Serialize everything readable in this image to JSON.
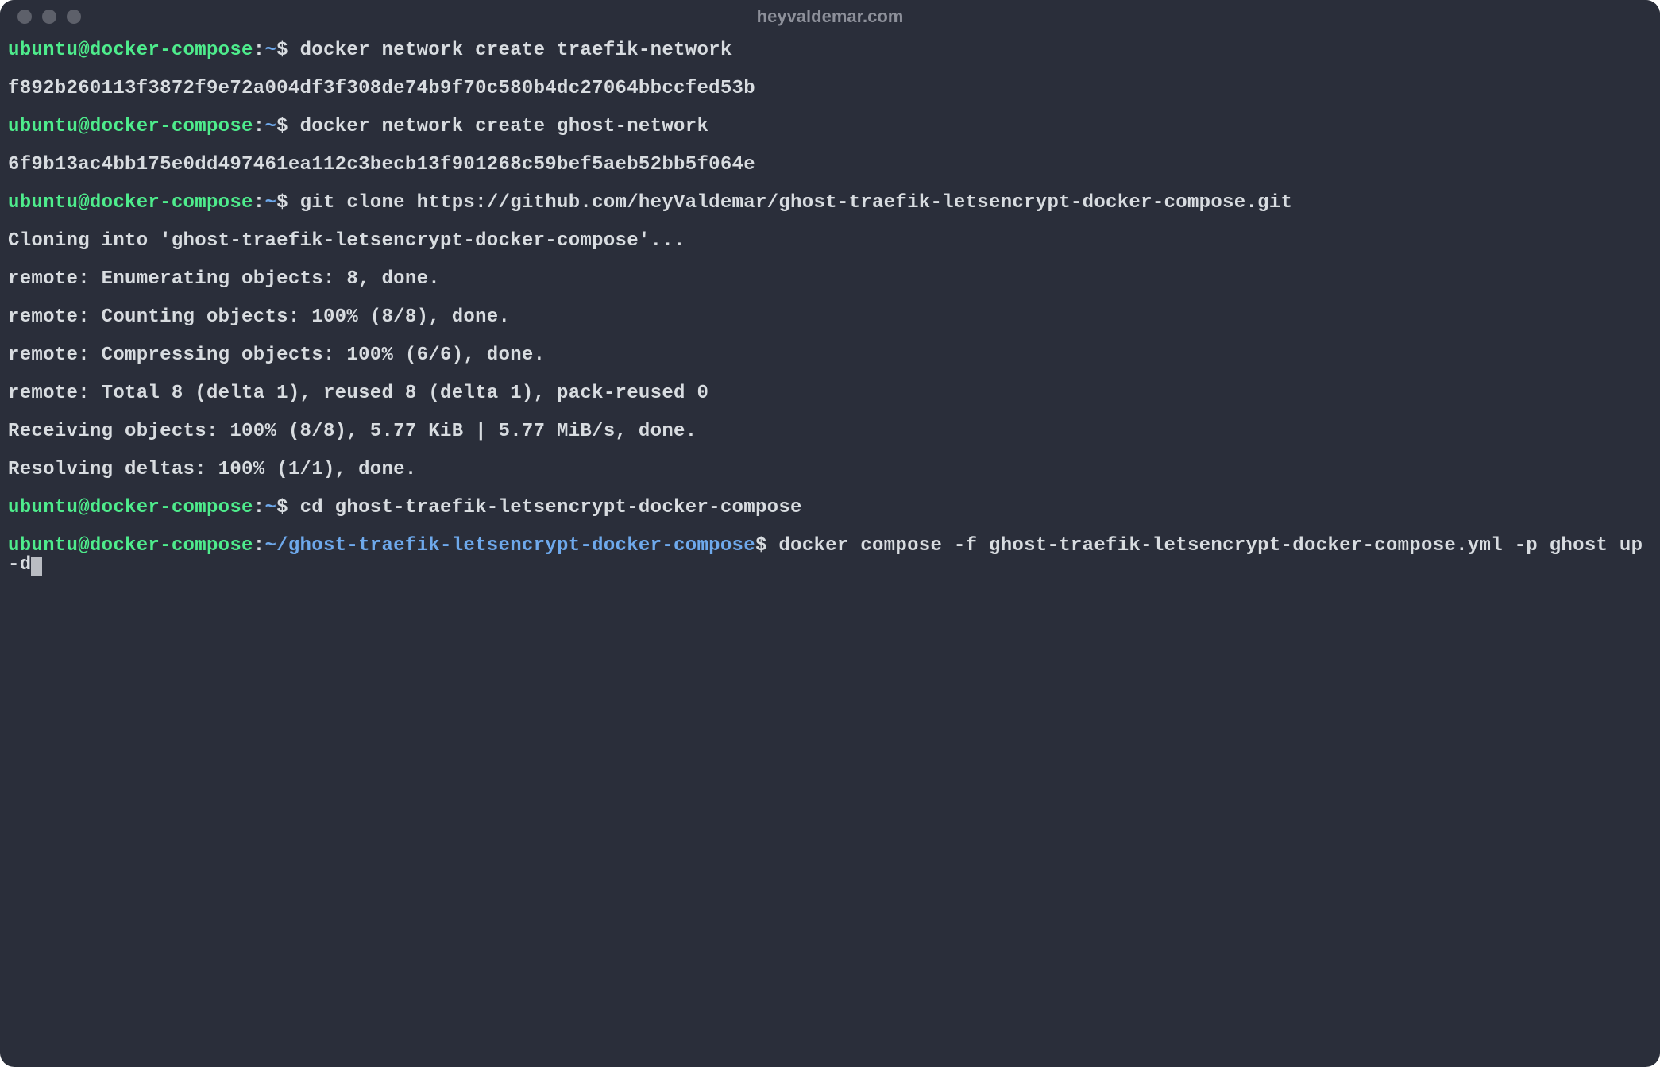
{
  "window": {
    "title": "heyvaldemar.com"
  },
  "prompt": {
    "user_host": "ubuntu@docker-compose",
    "sep": ":",
    "path_home": "~",
    "path_repo": "~/ghost-traefik-letsencrypt-docker-compose",
    "dollar": "$"
  },
  "lines": {
    "cmd1": "docker network create traefik-network",
    "out1": "f892b260113f3872f9e72a004df3f308de74b9f70c580b4dc27064bbccfed53b",
    "cmd2": "docker network create ghost-network",
    "out2": "6f9b13ac4bb175e0dd497461ea112c3becb13f901268c59bef5aeb52bb5f064e",
    "cmd3": "git clone https://github.com/heyValdemar/ghost-traefik-letsencrypt-docker-compose.git",
    "out3a": "Cloning into 'ghost-traefik-letsencrypt-docker-compose'...",
    "out3b": "remote: Enumerating objects: 8, done.",
    "out3c": "remote: Counting objects: 100% (8/8), done.",
    "out3d": "remote: Compressing objects: 100% (6/6), done.",
    "out3e": "remote: Total 8 (delta 1), reused 8 (delta 1), pack-reused 0",
    "out3f": "Receiving objects: 100% (8/8), 5.77 KiB | 5.77 MiB/s, done.",
    "out3g": "Resolving deltas: 100% (1/1), done.",
    "cmd4": "cd ghost-traefik-letsencrypt-docker-compose",
    "cmd5": "docker compose -f ghost-traefik-letsencrypt-docker-compose.yml -p ghost up -d"
  }
}
